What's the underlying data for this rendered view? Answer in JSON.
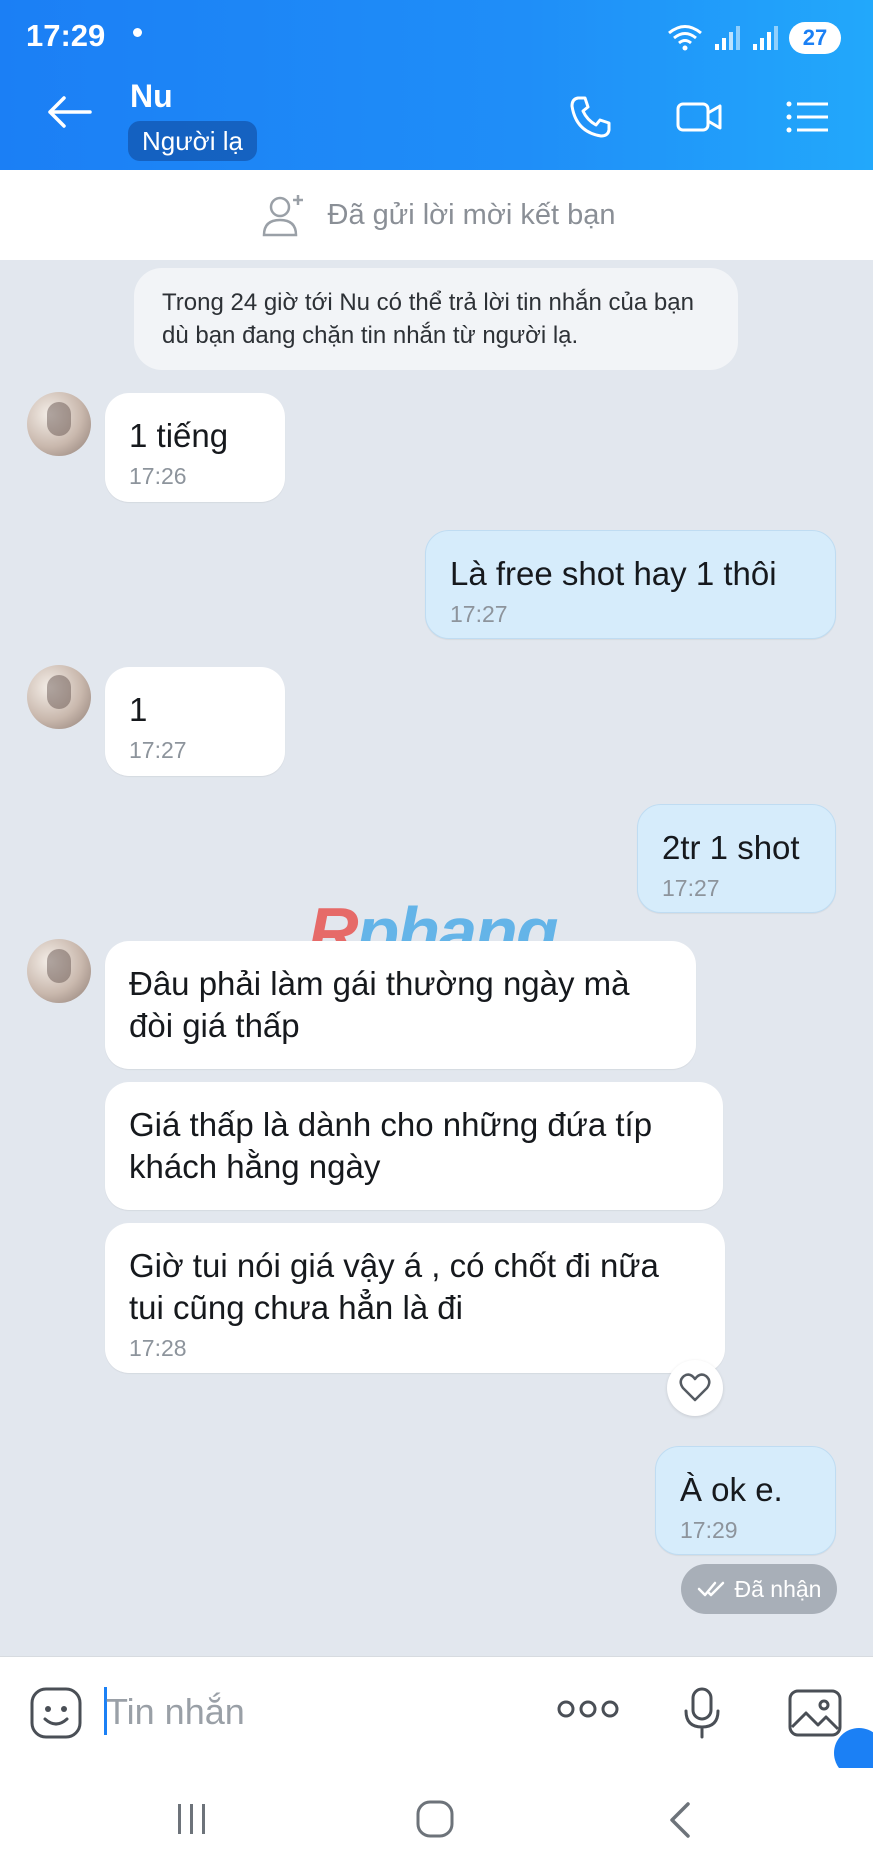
{
  "status_bar": {
    "time": "17:29",
    "battery": "27"
  },
  "header": {
    "contact_name": "Nu",
    "badge": "Người lạ"
  },
  "friend_request": {
    "text": "Đã gửi lời mời kết bạn"
  },
  "notice": {
    "text": "Trong 24 giờ tới Nu có thể trả lời tin nhắn của bạn dù bạn đang chặn tin nhắn từ người lạ."
  },
  "messages": [
    {
      "text": "1 tiếng",
      "time": "17:26"
    },
    {
      "text": "Là free shot hay 1 thôi",
      "time": "17:27"
    },
    {
      "text": "1",
      "time": "17:27"
    },
    {
      "text": "2tr 1 shot",
      "time": "17:27"
    },
    {
      "text": "Đâu phải làm gái thường ngày mà đòi giá thấp"
    },
    {
      "text": "Giá thấp là dành cho những đứa típ khách hằng ngày"
    },
    {
      "text": "Giờ tui nói giá vậy á , có chốt đi nữa tui cũng chưa hẳn là đi",
      "time": "17:28"
    },
    {
      "text": "À ok e.",
      "time": "17:29"
    }
  ],
  "delivery_status": "Đã nhận",
  "watermark": {
    "first": "R",
    "rest": "phang"
  },
  "input": {
    "placeholder": "Tin nhắn"
  },
  "colors": {
    "header_blue": "#1b80f5",
    "outgoing_bubble": "#d6ecfb",
    "incoming_bubble": "#ffffff",
    "chat_background": "#e2e7ee"
  }
}
